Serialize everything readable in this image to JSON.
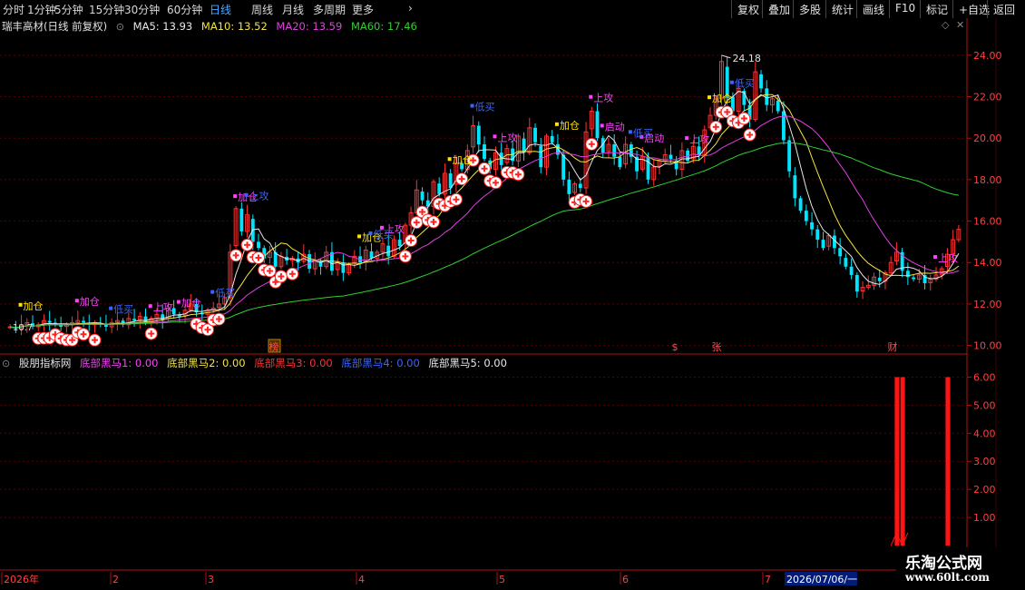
{
  "toolbar": {
    "left_items": [
      {
        "label": "分时",
        "active": false
      },
      {
        "label": "1分钟",
        "active": false
      },
      {
        "label": "5分钟",
        "active": false
      },
      {
        "label": "15分钟",
        "active": false
      },
      {
        "label": "30分钟",
        "active": false
      },
      {
        "label": "60分钟",
        "active": false
      },
      {
        "label": "日线",
        "active": true
      },
      {
        "label": "周线",
        "active": false
      },
      {
        "label": "月线",
        "active": false
      },
      {
        "label": "多周期",
        "active": false
      },
      {
        "label": "更多",
        "active": false
      }
    ],
    "right_items": [
      "复权",
      "叠加",
      "多股",
      "统计",
      "画线",
      "F10",
      "标记",
      "+自选",
      "返回"
    ]
  },
  "main_info": {
    "stock_name": "瑞丰高材(日线 前复权)",
    "ma5": "MA5: 13.93",
    "ma10": "MA10: 13.52",
    "ma20": "MA20: 13.59",
    "ma60": "MA60: 17.46"
  },
  "indicator_info": {
    "name": "股朋指标网",
    "v1": "底部黑马1: 0.00",
    "v2": "底部黑马2: 0.00",
    "v3": "底部黑马3: 0.00",
    "v4": "底部黑马4: 0.00",
    "v5": "底部黑马5: 0.00"
  },
  "colors": {
    "up": "#ff3232",
    "down": "#00e5ff",
    "ma5": "#e8e8e8",
    "ma10": "#f2e442",
    "ma20": "#e040e0",
    "ma60": "#2fd02f",
    "grid": "#5a0000",
    "axis": "#b01010",
    "label_blue": "#3a64ff",
    "label_yellow": "#ffe400",
    "label_magenta": "#ff40ff"
  },
  "price_axis": [
    "24.00",
    "22.00",
    "20.00",
    "18.00",
    "16.00",
    "14.00",
    "12.00",
    "10.00"
  ],
  "ind_axis": [
    "6.00",
    "5.00",
    "4.00",
    "3.00",
    "2.00",
    "1.00"
  ],
  "date_axis": [
    "2026年",
    "2",
    "3",
    "4",
    "5",
    "6",
    "7"
  ],
  "cursor_date": "2026/07/06/一",
  "max_label": "24.18",
  "low_label": "10.7",
  "event_markers": [
    {
      "text": "榜",
      "kind": "box"
    },
    {
      "text": "$",
      "kind": "plain"
    },
    {
      "text": "张",
      "kind": "plain"
    },
    {
      "text": "财",
      "kind": "plain"
    }
  ],
  "signal_words": {
    "add": "加仓",
    "attack": "上攻",
    "start": "启动",
    "bottom": "低买"
  },
  "watermark": {
    "line1": "乐淘公式网",
    "line2": "www.60lt.com"
  },
  "chart_data": {
    "type": "candlestick",
    "ylim": [
      9.5,
      25
    ],
    "close": [
      10.9,
      10.8,
      11.0,
      11.1,
      10.9,
      11.0,
      11.2,
      11.1,
      11.0,
      10.9,
      11.0,
      11.1,
      11.2,
      11.1,
      11.0,
      11.1,
      11.0,
      10.9,
      11.1,
      11.2,
      11.0,
      11.3,
      11.2,
      11.4,
      11.1,
      11.3,
      11.5,
      11.2,
      11.8,
      11.5,
      11.4,
      11.7,
      12.0,
      11.6,
      11.5,
      11.7,
      11.8,
      12.0,
      12.3,
      14.5,
      16.6,
      15.5,
      16.3,
      15.0,
      14.7,
      14.2,
      14.5,
      13.8,
      14.3,
      14.1,
      14.2,
      14.0,
      14.4,
      13.7,
      14.1,
      13.8,
      14.5,
      13.6,
      14.0,
      13.5,
      13.9,
      14.3,
      14.0,
      14.6,
      14.2,
      14.5,
      14.9,
      14.3,
      15.1,
      14.8,
      15.8,
      16.4,
      17.5,
      17.0,
      16.7,
      17.9,
      17.3,
      18.3,
      17.6,
      18.8,
      18.5,
      19.4,
      20.6,
      19.7,
      19.0,
      18.5,
      19.3,
      18.7,
      19.5,
      18.9,
      20.1,
      19.3,
      20.5,
      19.8,
      18.6,
      20.1,
      19.8,
      19.2,
      18.0,
      17.3,
      17.8,
      17.6,
      20.3,
      21.3,
      20.0,
      19.3,
      19.7,
      19.1,
      18.6,
      19.7,
      19.1,
      18.4,
      19.1,
      18.0,
      18.6,
      18.9,
      19.2,
      19.0,
      18.5,
      19.4,
      18.9,
      19.6,
      19.2,
      20.4,
      21.1,
      21.9,
      23.7,
      22.0,
      21.3,
      22.4,
      21.6,
      20.9,
      23.2,
      22.4,
      21.6,
      21.9,
      21.3,
      19.9,
      18.4,
      17.1,
      16.5,
      16.0,
      15.6,
      15.1,
      14.7,
      15.3,
      14.7,
      14.3,
      13.8,
      13.4,
      12.6,
      12.8,
      12.9,
      13.3,
      13.1,
      13.5,
      14.0,
      14.5,
      13.6,
      13.3,
      13.2,
      13.4,
      13.0,
      13.2,
      13.4,
      13.7,
      14.4,
      15.1,
      15.6
    ],
    "indicator_bars": [
      {
        "index": 157,
        "value": 6.0
      },
      {
        "index": 158,
        "value": 6.0
      },
      {
        "index": 166,
        "value": 6.0
      }
    ],
    "ind_ylim": [
      0,
      6.5
    ]
  }
}
